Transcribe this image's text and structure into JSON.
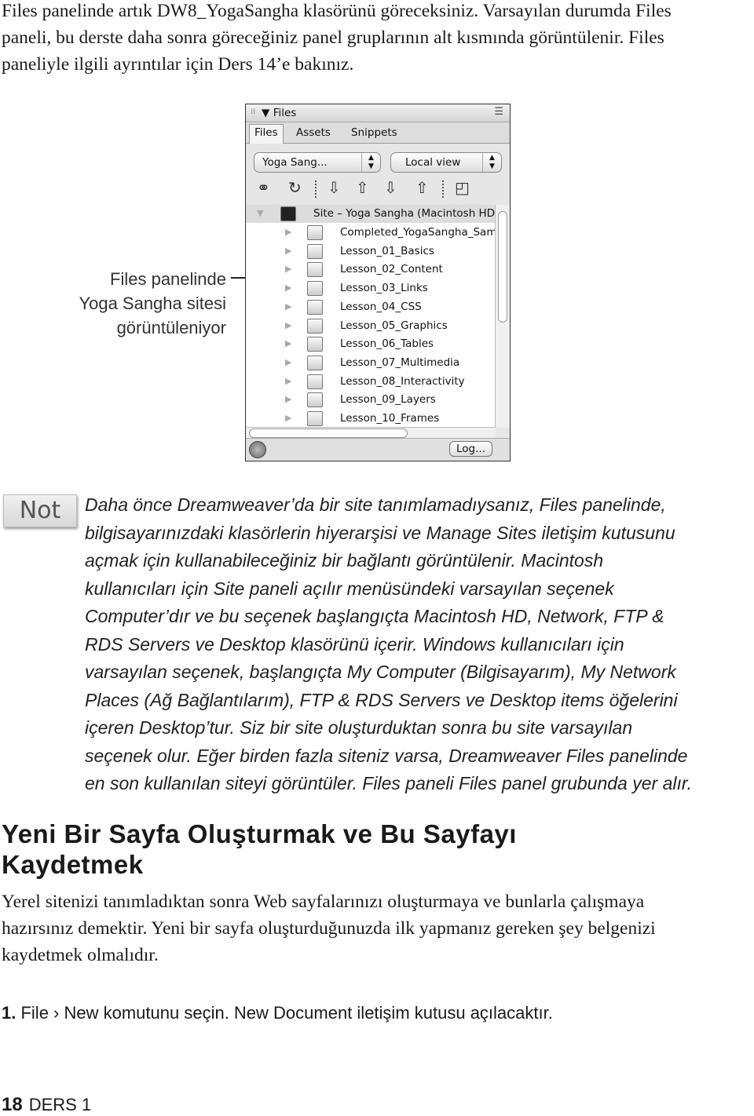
{
  "intro_lines": [
    "Files panelinde artık DW8_YogaSangha klasörünü göreceksiniz. Varsayılan durumda Files",
    "paneli, bu derste daha sonra göreceğiniz panel gruplarının alt kısmında görüntülenir. Files",
    "paneliyle ilgili ayrıntılar için Ders 14’e bakınız."
  ],
  "caption_lines": [
    "Files panelinde",
    "Yoga Sangha sitesi",
    "görüntüleniyor"
  ],
  "panel": {
    "title": "Files",
    "tabs": [
      {
        "label": "Files",
        "active": true
      },
      {
        "label": "Assets"
      },
      {
        "label": "Snippets"
      }
    ],
    "site_select": "Yoga Sang...",
    "view_select": "Local view",
    "toolbar_icons": [
      "connect-icon",
      "refresh-icon",
      "get-icon",
      "put-icon",
      "check-out-icon",
      "check-in-icon",
      "expand-icon"
    ],
    "root": "Site – Yoga Sangha (Macintosh HD",
    "folders": [
      "Completed_YogaSangha_Sam",
      "Lesson_01_Basics",
      "Lesson_02_Content",
      "Lesson_03_Links",
      "Lesson_04_CSS",
      "Lesson_05_Graphics",
      "Lesson_06_Tables",
      "Lesson_07_Multimedia",
      "Lesson_08_Interactivity",
      "Lesson_09_Layers",
      "Lesson_10_Frames"
    ],
    "log_button": "Log..."
  },
  "note": {
    "badge": "Not",
    "lines": [
      "Daha önce Dreamweaver’da bir site tanımlamadıysanız, Files panelinde,",
      "bilgisayarınızdaki klasörlerin hiyerarşisi ve Manage Sites iletişim kutusunu",
      "açmak için kullanabileceğiniz bir bağlantı görüntülenir. Macintosh",
      "kullanıcıları için Site paneli açılır menüsündeki varsayılan seçenek",
      "Computer’dır ve bu seçenek başlangıçta Macintosh HD, Network, FTP &",
      "RDS Servers ve Desktop klasörünü içerir. Windows kullanıcıları için",
      "varsayılan seçenek, başlangıçta My Computer (Bilgisayarım), My Network",
      "Places (Ağ Bağlantılarım), FTP & RDS Servers ve Desktop items öğelerini",
      "içeren Desktop’tur. Siz bir site oluşturduktan sonra bu site varsayılan",
      "seçenek olur. Eğer birden fazla siteniz varsa, Dreamweaver Files panelinde",
      "en son kullanılan siteyi görüntüler. Files paneli Files panel grubunda yer alır."
    ]
  },
  "heading_lines": [
    "Yeni Bir Sayfa Oluşturmak ve Bu Sayfayı",
    "Kaydetmek"
  ],
  "body_lines": [
    "Yerel sitenizi tanımladıktan sonra Web sayfalarınızı oluşturmaya ve bunlarla çalışmaya",
    "hazırsınız demektir. Yeni bir sayfa oluşturduğunuzda ilk yapmanız gereken şey belgenizi",
    "kaydetmek olmalıdır."
  ],
  "step": {
    "number": "1.",
    "text": "File › New komutunu seçin. New Document iletişim kutusu açılacaktır."
  },
  "footer": {
    "page": "18",
    "lesson": "DERS 1"
  }
}
